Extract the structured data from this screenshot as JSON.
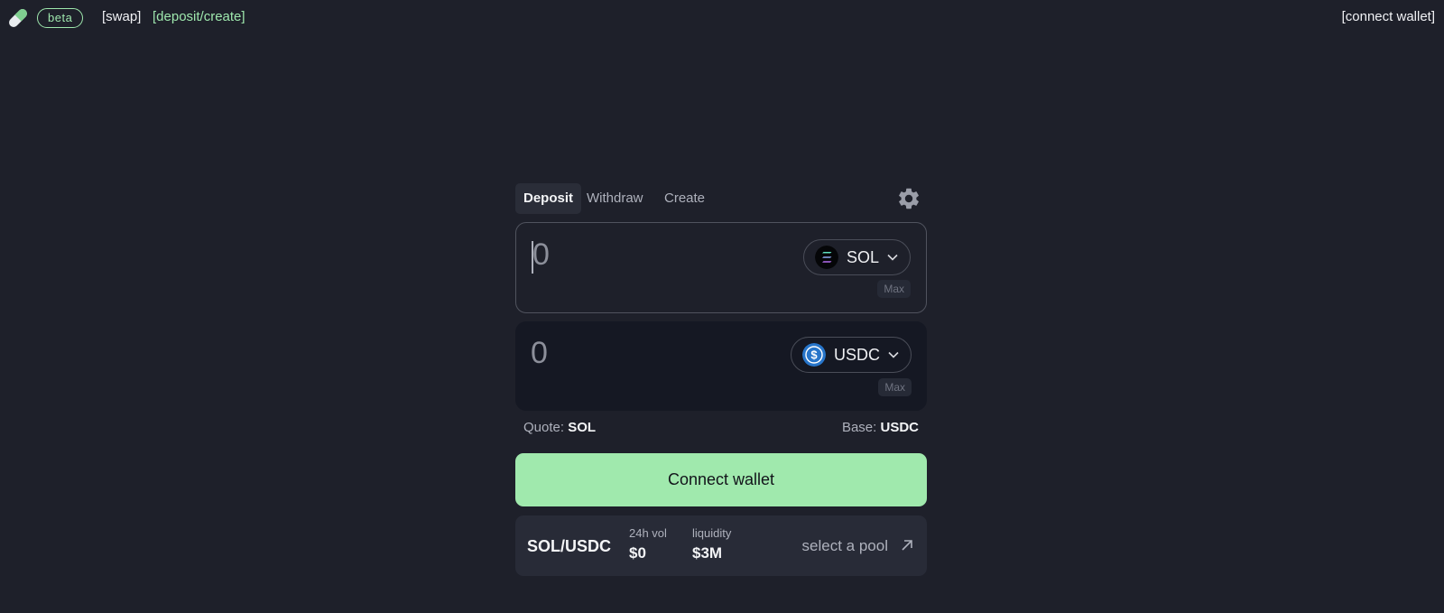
{
  "topbar": {
    "badge": "beta",
    "nav_swap": "[swap]",
    "nav_deposit": "[deposit/create]",
    "connect": "[connect wallet]"
  },
  "tabs": [
    "Deposit",
    "Withdraw",
    "Create"
  ],
  "active_tab": "Deposit",
  "inputs": [
    {
      "amount": "0",
      "token": "SOL",
      "max_label": "Max"
    },
    {
      "amount": "0",
      "token": "USDC",
      "max_label": "Max"
    }
  ],
  "quote": {
    "label": "Quote:",
    "value": "SOL"
  },
  "base": {
    "label": "Base:",
    "value": "USDC"
  },
  "connect_button": "Connect wallet",
  "pool": {
    "pair": "SOL/USDC",
    "vol_label": "24h vol",
    "vol_value": "$0",
    "liquidity_label": "liquidity",
    "liquidity_value": "$3M",
    "select_label": "select a pool"
  },
  "colors": {
    "background": "#1e202a",
    "accent": "#a0e9ad",
    "link_green": "#9ee7ad",
    "usdc_blue": "#2775ca"
  }
}
